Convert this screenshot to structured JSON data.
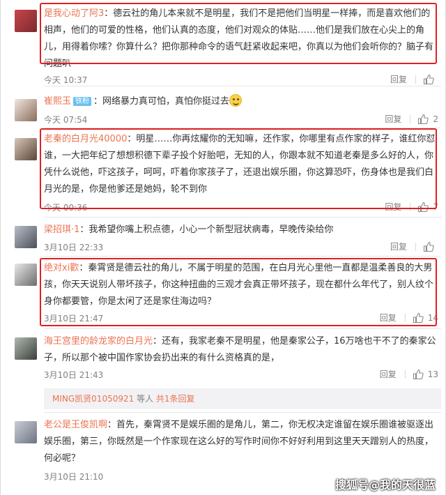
{
  "actions": {
    "reply_label": "回复"
  },
  "comments": [
    {
      "user": "是我心动了阿3",
      "sep": "：",
      "text": "德云社的角儿本来就不是明星，我们不是把他们当明星一样捧，而是喜欢他们的相声，他们的可爱的性格，他们认真的态度，他们对观众的体贴……他们是我们放在心尖上的角儿，用得着你嗦？你算什么？把你那种命令的语气赶紧收起来吧，你真以为他们会听你的？脑子有问题叭",
      "time": "今天 10:37",
      "likes": ""
    },
    {
      "user": "崔熙玉",
      "badge": "铁粉",
      "sep": "：",
      "text": "网络暴力真可怕，真怕你挺过去",
      "emoji": "smile-emoji",
      "time": "今天 07:54",
      "likes": "2"
    },
    {
      "user": "老秦的白月光40000",
      "sep": "：",
      "text": "明星……你再炫耀你的无知嘛，还作家，你哪里有点作家的样子，谁红你怼谁，一大把年纪了想想积德下辈子投个好胎吧，无知的人，你跟本就不知道老秦是多么好的人，你凭什么说他，吓这孩子，呵呵，吓着你家孩子了，还退出娱乐圈，你这算恐吓，伤身体也是我们白月光的是，你是他爹还是她妈，轮不到你",
      "time": "今天 00:36",
      "likes": "7"
    },
    {
      "user": "梁招琪·1",
      "sep": "：",
      "text": "我希望你嘴上积点德，小心一个新型冠状病毒，早晚传染给你",
      "time": "3月10日 22:33",
      "likes": ""
    },
    {
      "user": "绝对xi歡",
      "sep": "：",
      "text": "秦霄贤是德云社的角儿，不属于明星的范围，在白月光心里他一直都是温柔善良的大男孩，你天天说别人带坏孩子，你这种扭曲的三观才会真正带坏孩子，现在都什么年代了，别人纹个身你都要管，你是太闲了还是家住海边吗？",
      "time": "3月10日 21:47",
      "likes": "14"
    },
    {
      "user": "海王宫里的龄龙家的白月光",
      "sep": "：",
      "text": "还有，我家老秦不是明星，他是秦家公子，16万啥也干不了的秦家公子，所以那个被中国作家协会扔出来的有什么资格真的是，",
      "time": "3月10日 21:43",
      "likes": "13",
      "replies": {
        "user": "MING凯贤01050921",
        "mid": " 等人 ",
        "more": "共1条回复"
      }
    },
    {
      "user": "老公是王俊凯啊",
      "sep": "：",
      "text": "首先，秦霄贤不是娱乐圈的是角儿，第二，你无权决定谁留在娱乐圈谁被驱逐出娱乐圈，第三，你既然是一个作家现在这么好的写作时间你不好好利用到这里天天蹭别人的热度，何必呢？",
      "time": "3月10日 21:10",
      "likes": ""
    }
  ],
  "watermark": "搜狐号@我的天很蓝",
  "colors": {
    "username": "#eb7350",
    "highlight_box": "#e02020",
    "meta": "#808080"
  }
}
